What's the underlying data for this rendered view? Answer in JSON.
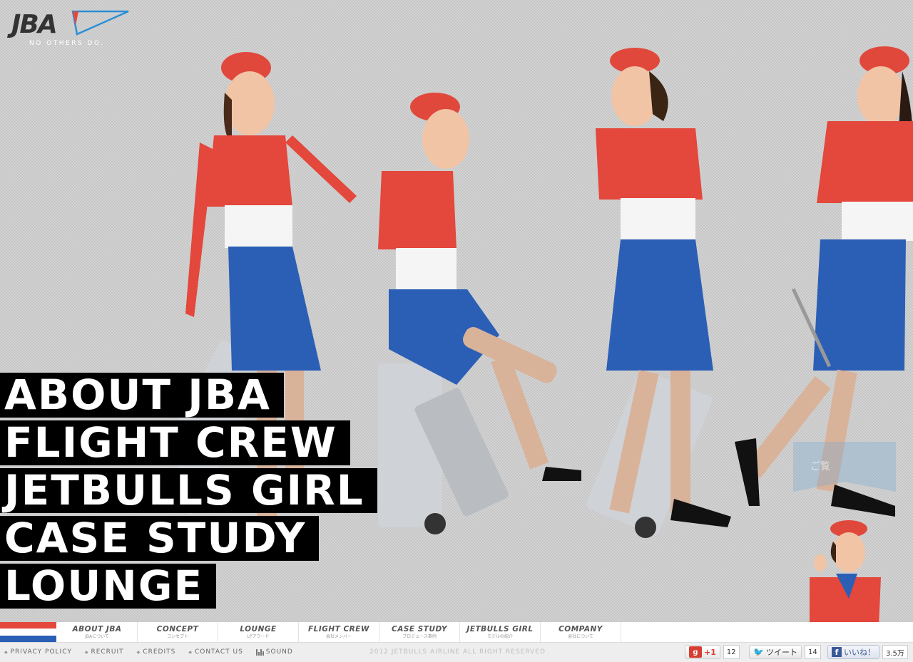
{
  "logo": {
    "text": "JBA",
    "tagline": "NO OTHERS DO."
  },
  "big_menu": [
    "ABOUT JBA",
    "FLIGHT CREW",
    "JETBULLS GIRL",
    "CASE STUDY",
    "LOUNGE"
  ],
  "side_widget": {
    "label": "ご覧"
  },
  "global_nav": [
    {
      "en": "ABOUT JBA",
      "jp": "JBAについて"
    },
    {
      "en": "CONCEPT",
      "jp": "コンセプト"
    },
    {
      "en": "LOUNGE",
      "jp": "LPアワード"
    },
    {
      "en": "FLIGHT CREW",
      "jp": "会社メンバー"
    },
    {
      "en": "CASE STUDY",
      "jp": "プロデュース事例"
    },
    {
      "en": "JETBULLS GIRL",
      "jp": "モデルの紹介"
    },
    {
      "en": "COMPANY",
      "jp": "会社について"
    }
  ],
  "footer": {
    "links": [
      "PRIVACY POLICY",
      "RECRUIT",
      "CREDITS",
      "CONTACT US"
    ],
    "sound": "SOUND",
    "copyright": "2012 JETBULLS AIRLINE ALL RIGHT RESERVED"
  },
  "social": {
    "gplus": {
      "icon": "g",
      "label": "+1",
      "count": "12"
    },
    "tweet": {
      "label": "ツイート",
      "count": "14"
    },
    "fb": {
      "icon": "f",
      "label": "いいね！",
      "count": "3.5万"
    }
  },
  "colors": {
    "red": "#e4473b",
    "white": "#ffffff",
    "blue": "#2b5fb5",
    "menu_bg": "#000000",
    "logo_blue": "#2b8fd6"
  }
}
